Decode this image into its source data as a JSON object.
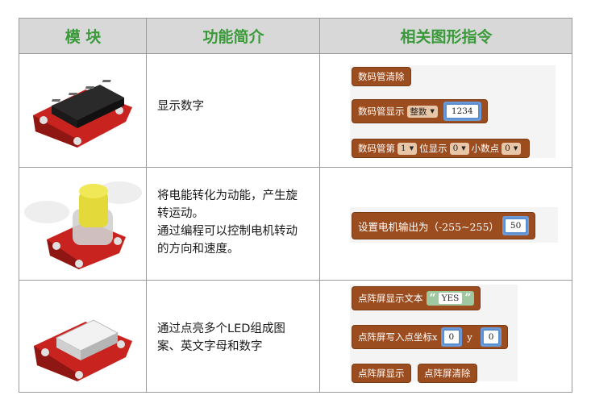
{
  "header": {
    "col_module": "模 块",
    "col_intro": "功能简介",
    "col_blocks": "相关图形指令"
  },
  "rows": [
    {
      "module_name": "seven-segment-display-module",
      "intro_lines": [
        "显示数字"
      ],
      "blocks": {
        "clear": "数码管清除",
        "display_label": "数码管显示",
        "display_type": "整数",
        "display_value": "1234",
        "pos_prefix": "数码管第",
        "pos_index": "1",
        "pos_middle": "位显示",
        "pos_value": "0",
        "pos_dot_label": "小数点",
        "pos_dot": "0"
      }
    },
    {
      "module_name": "motor-fan-module",
      "intro_lines": [
        "将电能转化为动能，产生旋",
        "转运动。",
        "通过编程可以控制电机转动",
        "的方向和速度。"
      ],
      "blocks": {
        "motor_label": "设置电机输出为（-255~255）",
        "motor_value": "50"
      }
    },
    {
      "module_name": "led-dot-matrix-module",
      "intro_lines": [
        "通过点亮多个LED组成图",
        "案、英文字母和数字"
      ],
      "blocks": {
        "text_label": "点阵屏显示文本",
        "text_value": "YES",
        "point_label": "点阵屏写入点坐标x",
        "x_value": "0",
        "y_label": "y",
        "y_value": "0",
        "show": "点阵屏显示",
        "clear": "点阵屏清除"
      }
    }
  ],
  "colors": {
    "header_text": "#3a9a3a",
    "block_brown": "#9c4d1f",
    "board_red": "#c8231f"
  }
}
